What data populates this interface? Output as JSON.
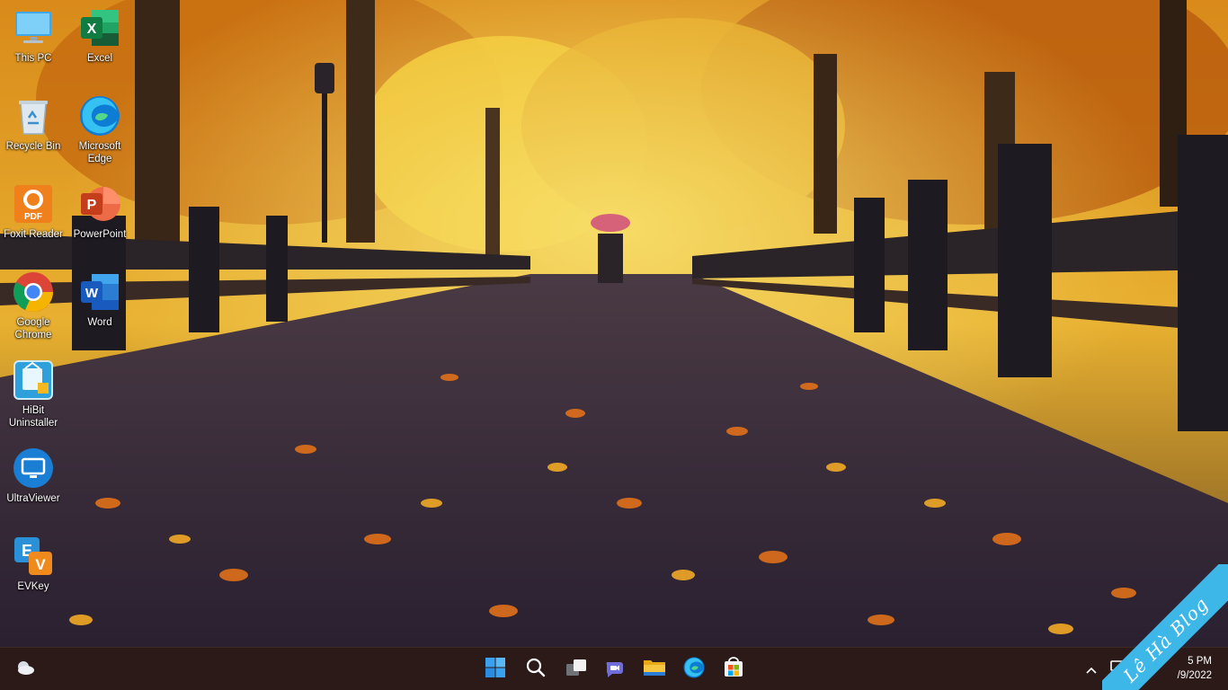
{
  "desktop": {
    "icons": [
      {
        "label": "This PC",
        "icon": "this-pc-icon"
      },
      {
        "label": "Excel",
        "icon": "excel-icon"
      },
      {
        "label": "Recycle Bin",
        "icon": "recycle-bin-icon"
      },
      {
        "label": "Microsoft\nEdge",
        "icon": "edge-icon"
      },
      {
        "label": "Foxit Reader",
        "icon": "foxit-reader-icon"
      },
      {
        "label": "PowerPoint",
        "icon": "powerpoint-icon"
      },
      {
        "label": "Google\nChrome",
        "icon": "chrome-icon"
      },
      {
        "label": "Word",
        "icon": "word-icon"
      },
      {
        "label": "HiBit\nUninstaller",
        "icon": "hibit-uninstaller-icon"
      },
      {
        "label": "UltraViewer",
        "icon": "ultraviewer-icon"
      },
      {
        "label": "EVKey",
        "icon": "evkey-icon"
      }
    ]
  },
  "taskbar": {
    "buttons": [
      {
        "icon": "weather-icon"
      },
      {
        "icon": "windows-start-icon"
      },
      {
        "icon": "search-icon"
      },
      {
        "icon": "task-view-icon"
      },
      {
        "icon": "teams-chat-icon"
      },
      {
        "icon": "file-explorer-icon"
      },
      {
        "icon": "edge-icon"
      },
      {
        "icon": "microsoft-store-icon"
      }
    ],
    "tray": {
      "time": "5 PM",
      "date": "/9/2022"
    }
  },
  "watermark": {
    "text": "Lê Hà Blog"
  },
  "colors": {
    "taskbar_bg": "#2b1a17",
    "ribbon": "#3db6e8",
    "excel": "#1f7a45",
    "word": "#2b5fb8",
    "powerpoint": "#d04a2a",
    "foxit": "#f0801c"
  }
}
